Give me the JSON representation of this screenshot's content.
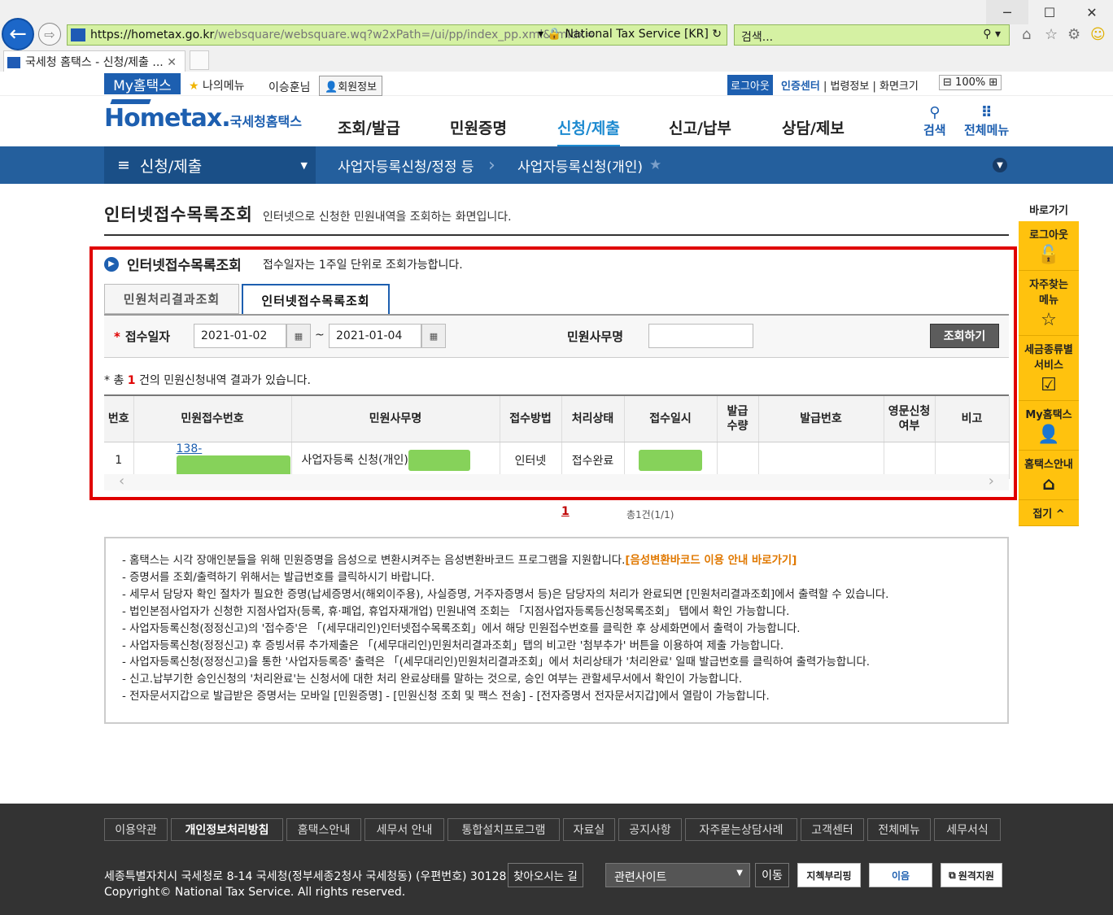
{
  "browser": {
    "url_host": "https://hometax.go.kr",
    "url_path": "/websquare/websquare.wq?w2xPath=/ui/pp/index_pp.xml&tmIdx=",
    "cert": "National Tax Service [KR]",
    "search_placeholder": "검색...",
    "tab_title": "국세청 홈택스 - 신청/제출 ...",
    "win_min": "─",
    "win_max": "☐",
    "win_close": "✕"
  },
  "topbar": {
    "myhome": "My홈택스",
    "mymenu": "나의메뉴",
    "user": "이승훈님",
    "member_info": "회원정보",
    "logout": "로그아웃",
    "cert_center": "인증센터",
    "law_info": "법령정보",
    "screen_size": "화면크기",
    "zoom": "100%"
  },
  "gnb": {
    "logo_text": "Hometax.",
    "logo_ko": "국세청홈택스",
    "menu": [
      "조회/발급",
      "민원증명",
      "신청/제출",
      "신고/납부",
      "상담/제보"
    ],
    "search": "검색",
    "all_menu": "전체메뉴"
  },
  "lnb": {
    "section": "신청/제출",
    "crumb1": "사업자등록신청/정정 등",
    "crumb2": "사업자등록신청(개인)"
  },
  "page": {
    "title": "인터넷접수목록조회",
    "desc": "인터넷으로 신청한 민원내역을 조회하는 화면입니다."
  },
  "section": {
    "title": "인터넷접수목록조회",
    "note": "접수일자는 1주일 단위로 조회가능합니다.",
    "tabs": [
      "민원처리결과조회",
      "인터넷접수목록조회"
    ],
    "date_label": "접수일자",
    "date_from": "2021-01-02",
    "date_to": "2021-01-04",
    "svc_label": "민원사무명",
    "search_btn": "조회하기",
    "result_prefix": "* 총",
    "result_count": "1",
    "result_suffix": "건의 민원신청내역 결과가 있습니다."
  },
  "grid": {
    "headers": [
      "번호",
      "민원접수번호",
      "민원사무명",
      "접수방법",
      "처리상태",
      "접수일시",
      "발급\n수량",
      "발급번호",
      "영문신청\n여부",
      "비고"
    ],
    "row": {
      "no": "1",
      "receipt": "138-",
      "svc": "사업자등록 신청(개인)",
      "method": "인터넷",
      "status": "접수완료"
    }
  },
  "pager": {
    "page": "1",
    "total": "총1건(1/1)"
  },
  "notice": [
    "- 홈택스는 시각 장애인분들을 위해 민원증명을 음성으로 변환시켜주는 음성변환바코드 프로그램을 지원합니다.",
    "[음성변환바코드 이용 안내 바로가기]",
    "- 증명서를 조회/출력하기 위해서는 발급번호를 클릭하시기 바랍니다.",
    "- 세무서 담당자 확인 절차가 필요한 증명(납세증명서(해외이주용), 사실증명, 거주자증명서 등)은 담당자의 처리가 완료되면 [민원처리결과조회]에서 출력할 수 있습니다.",
    "- 법인본점사업자가 신청한 지점사업자(등록, 휴·폐업, 휴업자재개업) 민원내역 조회는 「지점사업자등록등신청목록조회」 탭에서 확인 가능합니다.",
    "- 사업자등록신청(정정신고)의 '접수증'은 「(세무대리인)인터넷접수목록조회」에서 해당 민원접수번호를 클릭한 후 상세화면에서 출력이 가능합니다.",
    "- 사업자등록신청(정정신고) 후 증빙서류 추가제출은 「(세무대리인)민원처리결과조회」탭의 비고란 '첨부추가' 버튼을 이용하여 제출 가능합니다.",
    "- 사업자등록신청(정정신고)을 통한 '사업자등록증' 출력은 「(세무대리인)민원처리결과조회」에서 처리상태가 '처리완료' 일때 발급번호를 클릭하여 출력가능합니다.",
    "- 신고.납부기한 승인신청의 '처리완료'는 신청서에 대한 처리 완료상태를 말하는 것으로, 승인 여부는 관할세무서에서 확인이 가능합니다.",
    "- 전자문서지갑으로 발급받은 증명서는 모바일 [민원증명] - [민원신청 조회 및 팩스 전송] - [전자증명서 전자문서지갑]에서 열람이 가능합니다."
  ],
  "quick": {
    "head": "바로가기",
    "items": [
      "로그아웃",
      "자주찾는\n메뉴",
      "세금종류별\n서비스",
      "My홈택스",
      "홈택스안내",
      "접기"
    ]
  },
  "footer": {
    "links": [
      "이용약관",
      "개인정보처리방침",
      "홈택스안내",
      "세무서 안내",
      "통합설치프로그램",
      "자료실",
      "공지사항",
      "자주묻는상담사례",
      "고객센터",
      "전체메뉴",
      "세무서식"
    ],
    "address": "세종특별자치시 국세청로 8-14 국세청(정부세종2청사 국세청동) (우편번호) 30128",
    "directions": "찾아오시는 길",
    "copyright": "Copyright© National Tax Service. All rights reserved.",
    "related": "관련사이트",
    "go": "이동",
    "banners": [
      "지첵부리핑",
      "이음",
      "원격지원"
    ]
  }
}
